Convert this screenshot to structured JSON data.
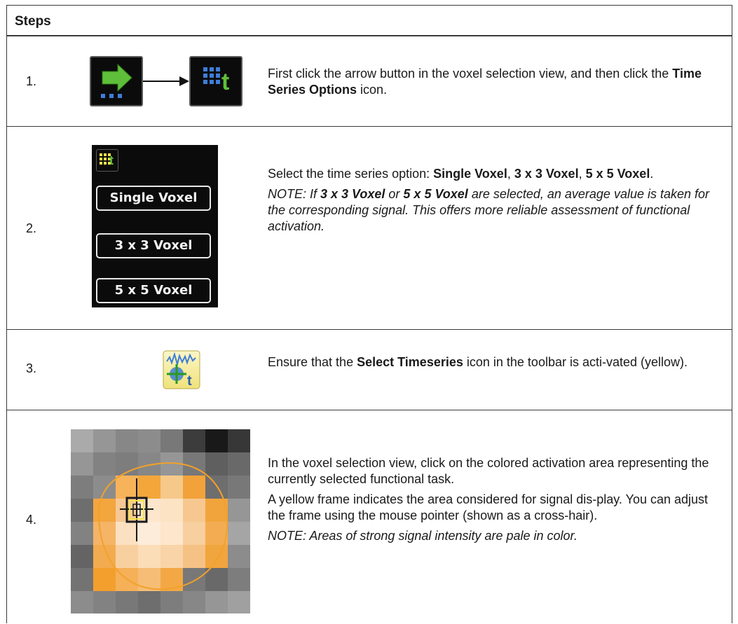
{
  "header": {
    "title": "Steps"
  },
  "steps": [
    {
      "number": "1.",
      "segments": [
        {
          "t": "First click the arrow button in the voxel selection view, and then click the "
        },
        {
          "t": "Time Series Options",
          "b": true
        },
        {
          "t": " icon."
        }
      ]
    },
    {
      "number": "2.",
      "segments": [
        {
          "t": "Select the time series option: "
        },
        {
          "t": "Single Voxel",
          "b": true
        },
        {
          "t": ", "
        },
        {
          "t": "3 x 3 Voxel",
          "b": true
        },
        {
          "t": ", "
        },
        {
          "t": "5 x 5 Voxel",
          "b": true
        },
        {
          "t": "."
        }
      ],
      "note": [
        {
          "t": "NOTE: If "
        },
        {
          "t": "3 x 3 Voxel",
          "b": true
        },
        {
          "t": " or "
        },
        {
          "t": "5 x 5 Voxel",
          "b": true
        },
        {
          "t": " are selected, an average value is taken for the corresponding signal. This offers more reliable assessment of functional activation."
        }
      ],
      "buttons": [
        "Single Voxel",
        "3 x 3 Voxel",
        "5 x 5 Voxel"
      ]
    },
    {
      "number": "3.",
      "segments": [
        {
          "t": "Ensure that the "
        },
        {
          "t": "Select Timeseries",
          "b": true
        },
        {
          "t": " icon in the toolbar is acti-vated (yellow)."
        }
      ]
    },
    {
      "number": "4.",
      "segments": [
        {
          "t": "In the voxel selection view, click on the colored activation area representing the currently selected functional task."
        }
      ],
      "segments2": [
        {
          "t": "A yellow frame indicates the area considered for signal dis-play. You can adjust the frame using the mouse pointer (shown as a cross-hair)."
        }
      ],
      "note": [
        {
          "t": "NOTE: Areas of strong signal intensity are pale in color."
        }
      ]
    }
  ],
  "icons": {
    "time_series_glyph": "t",
    "colors": {
      "arrow": "#5fbf3a",
      "dots": "#3e7ed8",
      "yellow": "#f3e24a",
      "orange": "#f6a62a"
    }
  }
}
